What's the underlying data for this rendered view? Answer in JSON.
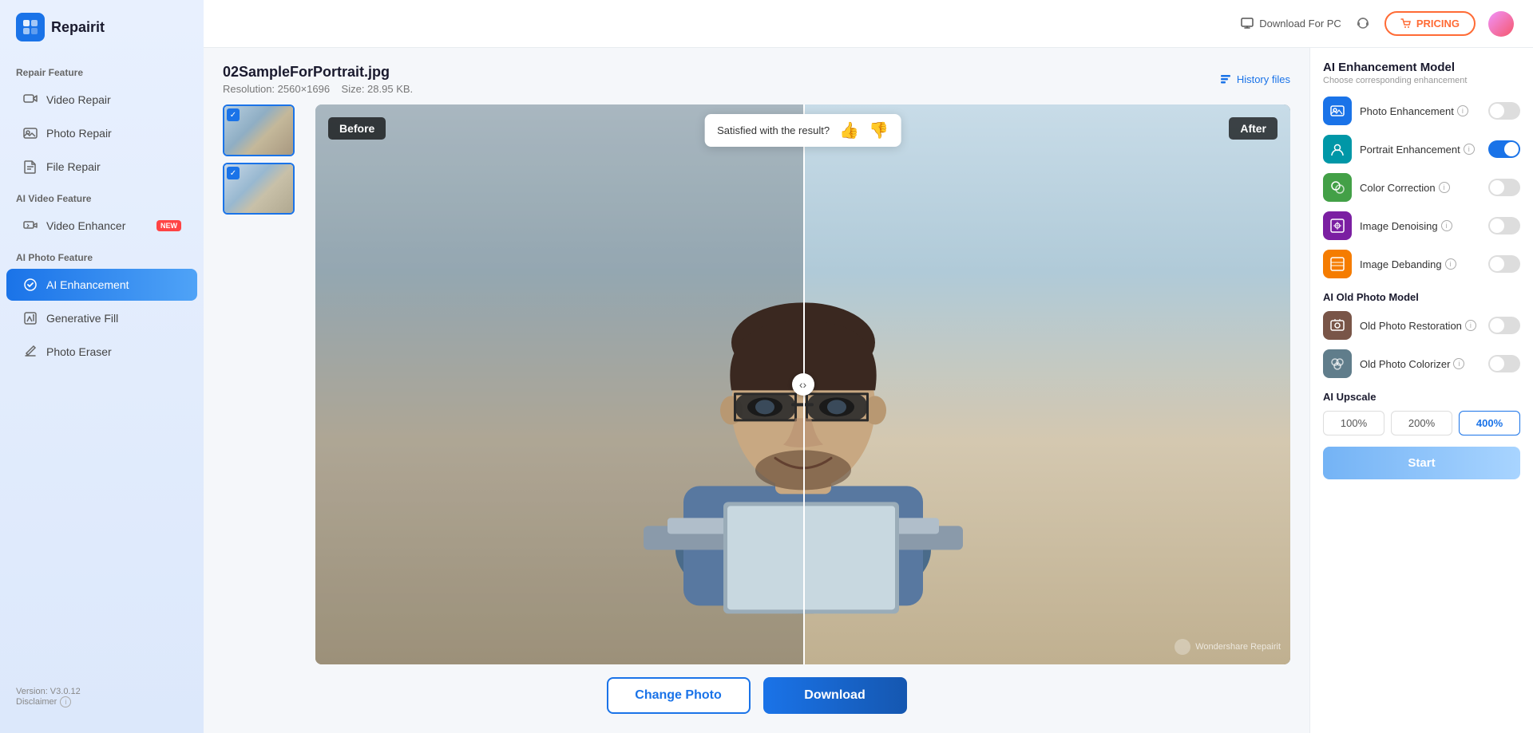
{
  "app": {
    "name": "Repairit",
    "version": "Version: V3.0.12"
  },
  "header": {
    "download_pc_label": "Download For PC",
    "pricing_label": "PRICING"
  },
  "sidebar": {
    "repair_feature_label": "Repair Feature",
    "video_repair_label": "Video Repair",
    "photo_repair_label": "Photo Repair",
    "file_repair_label": "File Repair",
    "ai_video_feature_label": "AI Video Feature",
    "video_enhancer_label": "Video Enhancer",
    "ai_photo_feature_label": "AI Photo Feature",
    "ai_enhancement_label": "AI Enhancement",
    "generative_fill_label": "Generative Fill",
    "photo_eraser_label": "Photo Eraser",
    "version_label": "Version: V3.0.12",
    "disclaimer_label": "Disclaimer"
  },
  "file_info": {
    "filename": "02SampleForPortrait.jpg",
    "resolution": "Resolution: 2560×1696",
    "size": "Size: 28.95 KB.",
    "history_label": "History files"
  },
  "preview": {
    "before_label": "Before",
    "after_label": "After",
    "satisfaction_text": "Satisfied with the result?",
    "watermark": "Wondershare Repairit"
  },
  "actions": {
    "change_photo_label": "Change Photo",
    "download_label": "Download"
  },
  "right_panel": {
    "model_title": "AI Enhancement Model",
    "model_subtitle": "Choose corresponding enhancement",
    "photo_enhancement_label": "Photo Enhancement",
    "portrait_enhancement_label": "Portrait Enhancement",
    "color_correction_label": "Color Correction",
    "image_denoising_label": "Image Denoising",
    "image_debanding_label": "Image Debanding",
    "old_photo_model_title": "AI Old Photo Model",
    "old_photo_restoration_label": "Old Photo Restoration",
    "old_photo_colorizer_label": "Old Photo Colorizer",
    "ai_upscale_title": "AI Upscale",
    "upscale_100": "100%",
    "upscale_200": "200%",
    "upscale_400": "400%",
    "start_label": "Start",
    "new_badge": "NEW"
  }
}
